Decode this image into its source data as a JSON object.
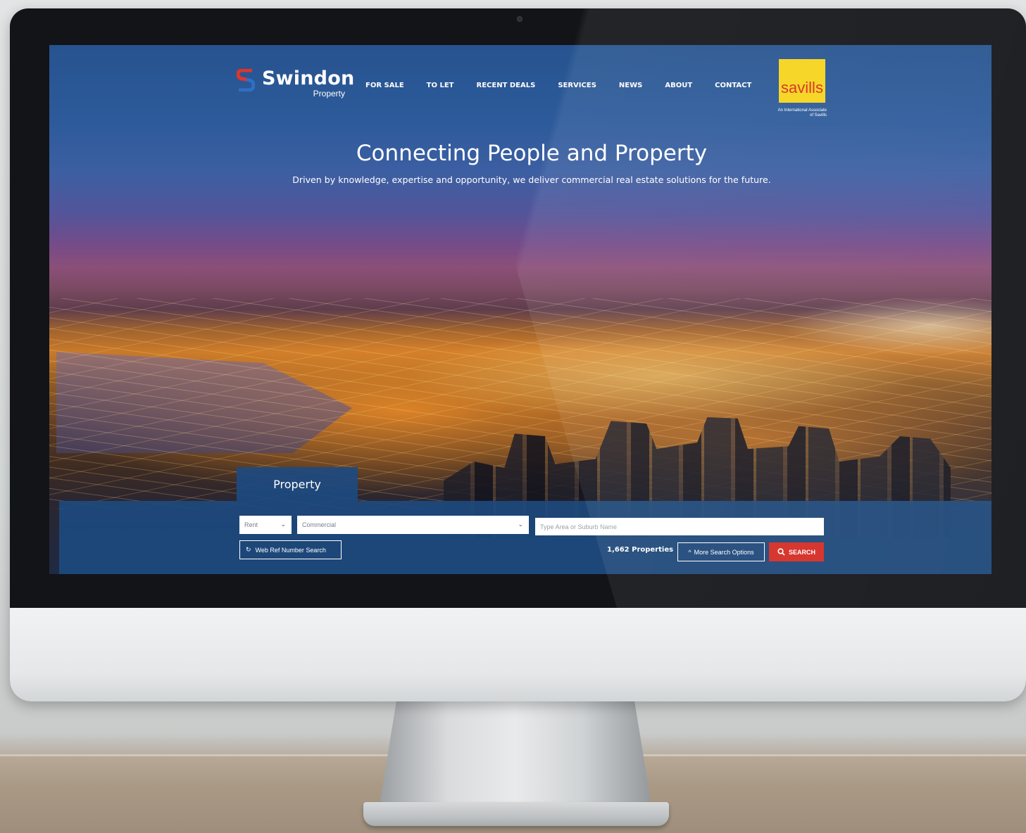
{
  "header": {
    "brand_name": "Swindon",
    "brand_sub": "Property",
    "nav": [
      "FOR SALE",
      "TO LET",
      "RECENT DEALS",
      "SERVICES",
      "NEWS",
      "ABOUT",
      "CONTACT"
    ],
    "partner_logo": "savills",
    "partner_tagline": "An International Associate of Savills"
  },
  "hero": {
    "title": "Connecting People and Property",
    "subtitle": "Driven by knowledge, expertise and opportunity, we deliver commercial real estate solutions for the future."
  },
  "search": {
    "tab_label": "Property",
    "listing_type_value": "Rent",
    "property_type_value": "Commercial",
    "area_placeholder": "Type Area or Suburb Name",
    "web_ref_label": "Web Ref Number Search",
    "result_count": "1,662 Properties",
    "more_options_label": "More Search Options",
    "search_label": "SEARCH"
  },
  "colors": {
    "panel_blue": "#1d4a80",
    "search_red": "#d42a22",
    "savills_yellow": "#f6d31a",
    "savills_red": "#d52b1e",
    "logo_red": "#e0342b",
    "logo_blue": "#2f6fc4"
  },
  "icons": {
    "web_ref_icon": "refresh-icon",
    "more_options_icon": "chevron-up-icon",
    "search_icon": "search-icon",
    "select_icon": "chevron-down-icon"
  }
}
